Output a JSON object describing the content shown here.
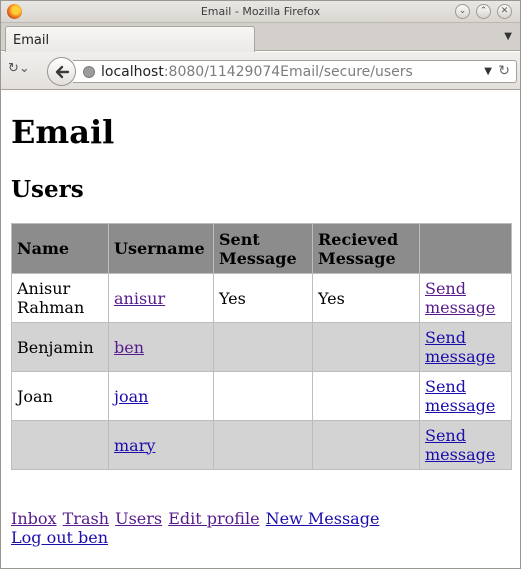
{
  "window": {
    "title": "Email - Mozilla Firefox"
  },
  "tabs": [
    {
      "label": "Email"
    }
  ],
  "navbar": {
    "url_host": "localhost",
    "url_rest": ":8080/11429074Email/secure/users"
  },
  "page": {
    "heading": "Email",
    "subheading": "Users"
  },
  "table": {
    "headers": [
      "Name",
      "Username",
      "Sent Message",
      "Recieved Message",
      ""
    ],
    "rows": [
      {
        "name": "Anisur Rahman",
        "username": "anisur",
        "sent": "Yes",
        "received": "Yes",
        "action": "Send message"
      },
      {
        "name": "Benjamin",
        "username": "ben",
        "sent": "",
        "received": "",
        "action": "Send message"
      },
      {
        "name": "Joan",
        "username": "joan",
        "sent": "",
        "received": "",
        "action": "Send message"
      },
      {
        "name": "",
        "username": "mary",
        "sent": "",
        "received": "",
        "action": "Send message"
      }
    ]
  },
  "footer": {
    "inbox": "Inbox",
    "trash": "Trash",
    "users": "Users",
    "edit_profile": "Edit profile",
    "new_message": "New Message",
    "logout": "Log out ben"
  },
  "icons": {
    "app": "firefox-logo-icon",
    "minimize": "chevron-down-icon",
    "maximize": "chevron-up-icon",
    "close": "close-icon",
    "back": "back-arrow-icon",
    "site": "globe-icon",
    "reload": "reload-icon"
  },
  "colors": {
    "link": "#1a0dab",
    "link_visited": "#551a8b",
    "table_header_bg": "#8c8c8c",
    "row_alt_bg": "#d3d3d3"
  }
}
